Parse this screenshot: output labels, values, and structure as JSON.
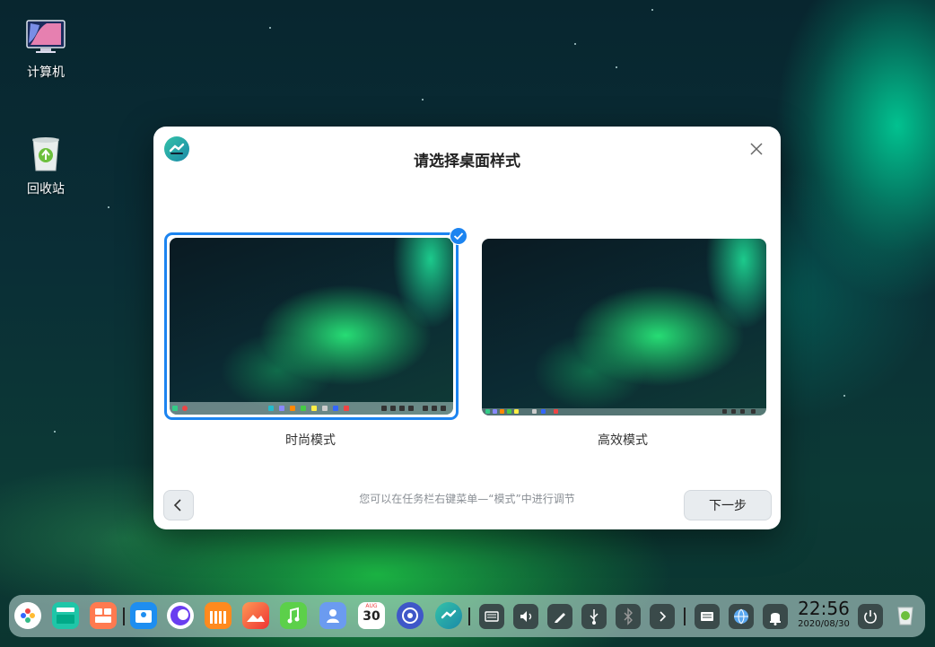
{
  "desktop": {
    "icons": [
      {
        "label": "计算机",
        "icon": "computer-icon"
      },
      {
        "label": "回收站",
        "icon": "trash-icon"
      }
    ]
  },
  "dialog": {
    "title": "请选择桌面样式",
    "options": [
      {
        "label": "时尚模式",
        "selected": true
      },
      {
        "label": "高效模式",
        "selected": false
      }
    ],
    "hint": "您可以在任务栏右键菜单—“模式”中进行调节",
    "next_label": "下一步",
    "accent": "#1c84f0"
  },
  "taskbar": {
    "apps": [
      "launcher-icon",
      "multitask-icon",
      "app-store-icon",
      "file-manager-icon",
      "browser-icon",
      "music-store-icon",
      "image-viewer-icon",
      "music-icon",
      "contacts-icon",
      "calendar-icon",
      "settings-icon",
      "assistant-icon"
    ],
    "calendar": {
      "month": "AUG",
      "day": "30"
    },
    "tray": [
      "keyboard-icon",
      "volume-icon",
      "pen-icon",
      "usb-icon",
      "bluetooth-icon",
      "expand-icon",
      "input-method-icon",
      "network-icon",
      "notification-icon",
      "power-icon",
      "trash-icon"
    ],
    "time": "22:56",
    "date": "2020/08/30"
  }
}
